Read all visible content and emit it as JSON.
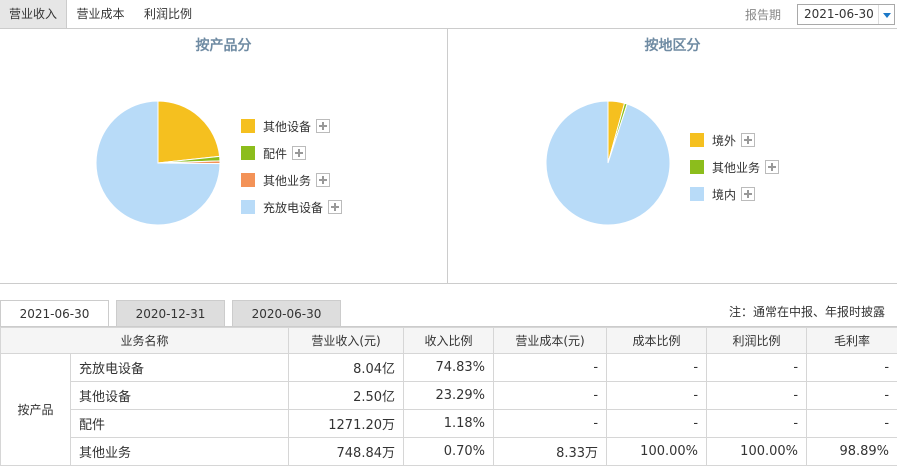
{
  "top_tabs": [
    "营业收入",
    "营业成本",
    "利润比例"
  ],
  "report": {
    "label": "报告期",
    "value": "2021-06-30"
  },
  "product_panel": {
    "title": "按产品分",
    "legend": [
      {
        "label": "其他设备",
        "color": "#f5c01f"
      },
      {
        "label": "配件",
        "color": "#8cbd1c"
      },
      {
        "label": "其他业务",
        "color": "#f39257"
      },
      {
        "label": "充放电设备",
        "color": "#b8dbf8"
      }
    ]
  },
  "region_panel": {
    "title": "按地区分",
    "legend": [
      {
        "label": "境外",
        "color": "#f5c01f"
      },
      {
        "label": "其他业务",
        "color": "#8cbd1c"
      },
      {
        "label": "境内",
        "color": "#b8dbf8"
      }
    ]
  },
  "chart_data": [
    {
      "type": "pie",
      "title": "按产品分",
      "categories": [
        "其他设备",
        "配件",
        "其他业务",
        "充放电设备"
      ],
      "values": [
        23.29,
        1.18,
        0.7,
        74.83
      ],
      "colors": [
        "#f5c01f",
        "#8cbd1c",
        "#f39257",
        "#b8dbf8"
      ]
    },
    {
      "type": "pie",
      "title": "按地区分",
      "categories": [
        "境外",
        "其他业务",
        "境内"
      ],
      "values": [
        4.3,
        0.7,
        95.0
      ],
      "colors": [
        "#f5c01f",
        "#8cbd1c",
        "#b8dbf8"
      ]
    }
  ],
  "date_tabs": [
    "2021-06-30",
    "2020-12-31",
    "2020-06-30"
  ],
  "note": "注：通常在中报、年报时披露",
  "table": {
    "headers": [
      "业务名称",
      "营业收入(元)",
      "收入比例",
      "营业成本(元)",
      "成本比例",
      "利润比例",
      "毛利率"
    ],
    "group": "按产品分",
    "group_label": "按产品",
    "rows": [
      [
        "充放电设备",
        "8.04亿",
        "74.83%",
        "-",
        "-",
        "-",
        "-"
      ],
      [
        "其他设备",
        "2.50亿",
        "23.29%",
        "-",
        "-",
        "-",
        "-"
      ],
      [
        "配件",
        "1271.20万",
        "1.18%",
        "-",
        "-",
        "-",
        "-"
      ],
      [
        "其他业务",
        "748.84万",
        "0.70%",
        "8.33万",
        "100.00%",
        "100.00%",
        "98.89%"
      ]
    ]
  }
}
